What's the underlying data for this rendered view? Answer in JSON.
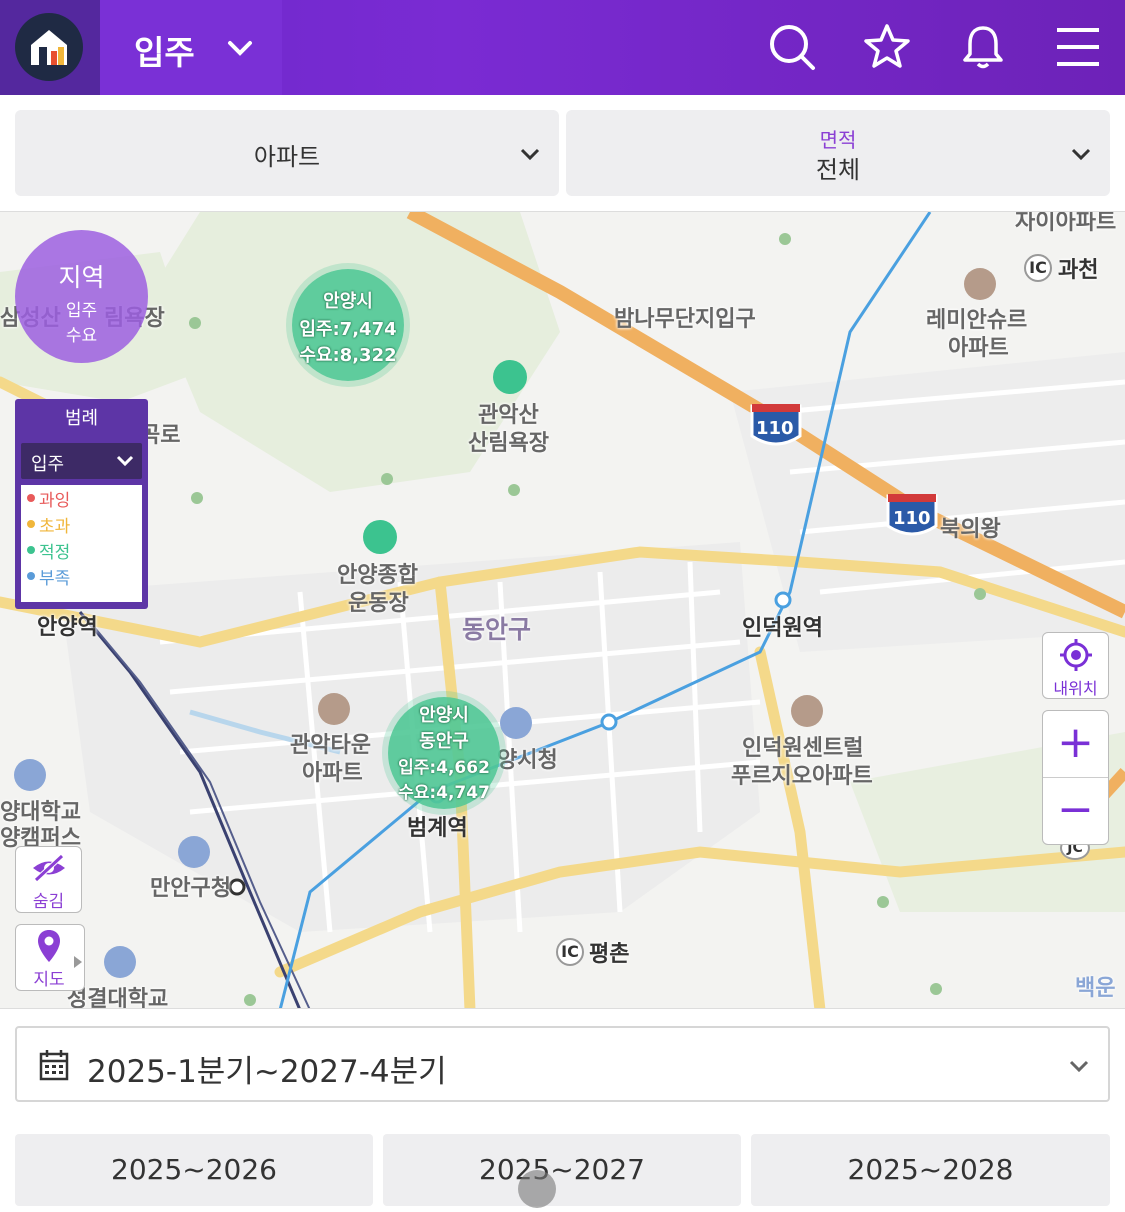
{
  "header": {
    "menu_label": "입주",
    "logo_icon": "home-logo-icon",
    "icons": [
      "search-icon",
      "star-icon",
      "bell-icon",
      "menu-icon"
    ]
  },
  "filters": {
    "type_value": "아파트",
    "area_label": "면적",
    "area_value": "전체"
  },
  "map": {
    "region_circle": {
      "title": "지역",
      "line1": "입주",
      "line2": "수요"
    },
    "legend": {
      "title": "범례",
      "selected": "입주",
      "items": [
        {
          "label": "과잉",
          "color": "#e85a5a"
        },
        {
          "label": "초과",
          "color": "#f0b63a"
        },
        {
          "label": "적정",
          "color": "#3cc38f"
        },
        {
          "label": "부족",
          "color": "#5a9bd8"
        }
      ]
    },
    "clusters": [
      {
        "name1": "안양시",
        "name2": "",
        "supply": "입주:7,474",
        "demand": "수요:8,322"
      },
      {
        "name1": "안양시",
        "name2": "동안구",
        "supply": "입주:4,662",
        "demand": "수요:4,747"
      }
    ],
    "labels": {
      "l1": "삼성산",
      "l2": "림욕장",
      "l3": "밤나무단지입구",
      "l4": "레미안슈르",
      "l5": "아파트",
      "l6": "과천",
      "l7": "관악산",
      "l8": "산림욕장",
      "l9": "안양종합",
      "l10": "운동장",
      "l11": "동안구",
      "l12": "인덕원역",
      "l13": "북의왕",
      "l14": "안양역",
      "l15": "관악타운",
      "l16": "아파트",
      "l17": "양시청",
      "l18": "인덕원센트럴",
      "l19": "푸르지오아파트",
      "l20": "범계역",
      "l21": "양대학교",
      "l22": "양캠퍼스",
      "l23": "만안구청",
      "l24": "평촌",
      "l25": "성결대학교",
      "l26": "백운",
      "l27": "곡로",
      "l28": "자이아파트",
      "l29": "110",
      "l30": "110",
      "l31": "IC",
      "l32": "IC",
      "l33": "JC"
    },
    "buttons": {
      "my_location": "내위치",
      "hide": "숨김",
      "map": "지도",
      "zoom_in": "+",
      "zoom_out": "−"
    }
  },
  "date_range": {
    "value": "2025-1분기~2027-4분기"
  },
  "periods": [
    "2025~2026",
    "2025~2027",
    "2025~2028"
  ]
}
